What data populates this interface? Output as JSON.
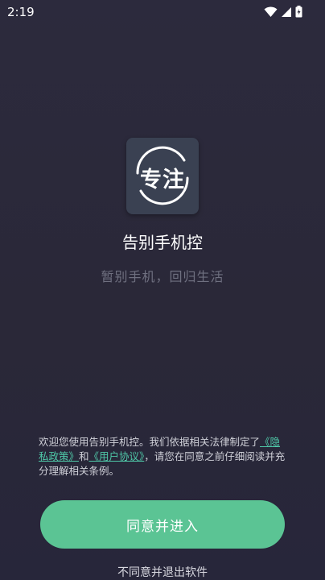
{
  "status_bar": {
    "time": "2:19"
  },
  "app": {
    "icon_text": "专注",
    "title": "告别手机控",
    "subtitle": "暂别手机，回归生活"
  },
  "notice": {
    "text_prefix": "欢迎您使用告别手机控。我们依据相关法律制定了",
    "privacy_link": "《隐私政策》",
    "and": "和",
    "agreement_link": "《用户协议》",
    "text_suffix": "，请您在同意之前仔细阅读并充分理解相关条例。"
  },
  "buttons": {
    "agree": "同意并进入",
    "decline": "不同意并退出软件"
  },
  "colors": {
    "accent": "#5bc494",
    "link": "#4fc8a8",
    "background": "#2a2838"
  }
}
